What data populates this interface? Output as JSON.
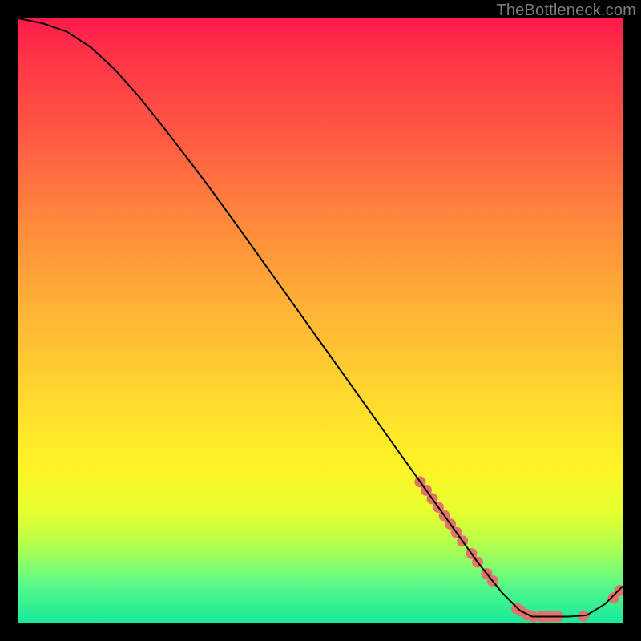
{
  "watermark": "TheBottleneck.com",
  "colors": {
    "curve": "#000000",
    "marker": "#e2736c",
    "background_top": "#ff1a4a",
    "background_bottom": "#18e99b"
  },
  "chart_data": {
    "type": "line",
    "title": "",
    "xlabel": "",
    "ylabel": "",
    "xlim": [
      0,
      100
    ],
    "ylim": [
      0,
      100
    ],
    "grid": false,
    "legend": false,
    "curve": [
      {
        "x": 0,
        "y": 100.0
      },
      {
        "x": 4,
        "y": 99.2
      },
      {
        "x": 8,
        "y": 97.8
      },
      {
        "x": 12,
        "y": 95.2
      },
      {
        "x": 16,
        "y": 91.5
      },
      {
        "x": 20,
        "y": 87.0
      },
      {
        "x": 24,
        "y": 82.0
      },
      {
        "x": 28,
        "y": 76.8
      },
      {
        "x": 32,
        "y": 71.5
      },
      {
        "x": 36,
        "y": 66.0
      },
      {
        "x": 40,
        "y": 60.4
      },
      {
        "x": 44,
        "y": 54.8
      },
      {
        "x": 48,
        "y": 49.2
      },
      {
        "x": 52,
        "y": 43.6
      },
      {
        "x": 56,
        "y": 38.0
      },
      {
        "x": 60,
        "y": 32.4
      },
      {
        "x": 64,
        "y": 26.8
      },
      {
        "x": 68,
        "y": 21.2
      },
      {
        "x": 72,
        "y": 15.6
      },
      {
        "x": 76,
        "y": 10.0
      },
      {
        "x": 80,
        "y": 5.0
      },
      {
        "x": 83,
        "y": 2.0
      },
      {
        "x": 85,
        "y": 1.0
      },
      {
        "x": 88,
        "y": 1.0
      },
      {
        "x": 91,
        "y": 1.0
      },
      {
        "x": 94,
        "y": 1.2
      },
      {
        "x": 97,
        "y": 3.0
      },
      {
        "x": 100,
        "y": 6.0
      }
    ],
    "markers": [
      {
        "x": 66.5,
        "y": 23.3
      },
      {
        "x": 67.5,
        "y": 21.9
      },
      {
        "x": 68.5,
        "y": 20.5
      },
      {
        "x": 69.5,
        "y": 19.1
      },
      {
        "x": 70.5,
        "y": 17.7
      },
      {
        "x": 71.5,
        "y": 16.3
      },
      {
        "x": 72.5,
        "y": 14.9
      },
      {
        "x": 73.5,
        "y": 13.5
      },
      {
        "x": 75.0,
        "y": 11.4
      },
      {
        "x": 76.0,
        "y": 10.0
      },
      {
        "x": 77.5,
        "y": 8.1
      },
      {
        "x": 78.5,
        "y": 6.9
      },
      {
        "x": 82.5,
        "y": 2.3
      },
      {
        "x": 83.2,
        "y": 1.9
      },
      {
        "x": 84.2,
        "y": 1.3
      },
      {
        "x": 85.2,
        "y": 1.0
      },
      {
        "x": 86.6,
        "y": 1.0
      },
      {
        "x": 87.5,
        "y": 1.0
      },
      {
        "x": 88.3,
        "y": 1.0
      },
      {
        "x": 89.3,
        "y": 1.0
      },
      {
        "x": 93.5,
        "y": 1.1
      },
      {
        "x": 98.5,
        "y": 4.1
      },
      {
        "x": 99.5,
        "y": 5.3
      }
    ],
    "marker_radius_px": 7
  }
}
